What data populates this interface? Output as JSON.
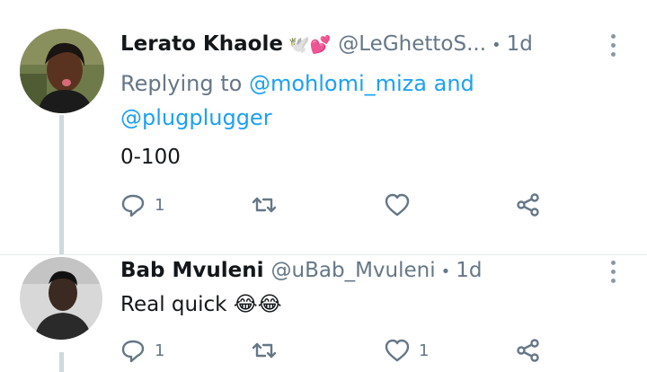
{
  "tweets": [
    {
      "name": "Lerato Khaole",
      "name_emoji": "🕊️💕",
      "handle": "@LeGhettoS...",
      "time": "1d",
      "reply_prefix": "Replying to",
      "reply_mention_1": "@mohlomi_miza",
      "reply_and": "and",
      "reply_mention_2": "@plugplugger",
      "text": "0-100",
      "reply_count": "1",
      "retweet_count": "",
      "like_count": ""
    },
    {
      "name": "Bab Mvuleni",
      "handle": "@uBab_Mvuleni",
      "time": "1d",
      "text": "Real quick 😂😂",
      "reply_count": "1",
      "retweet_count": "",
      "like_count": "1"
    }
  ],
  "icons": {
    "reply": "reply-icon",
    "retweet": "retweet-icon",
    "like": "heart-icon",
    "share": "share-icon",
    "menu": "more-vertical-icon"
  },
  "colors": {
    "mention": "#1da1f2",
    "secondary": "#657786",
    "icon": "#657786"
  }
}
